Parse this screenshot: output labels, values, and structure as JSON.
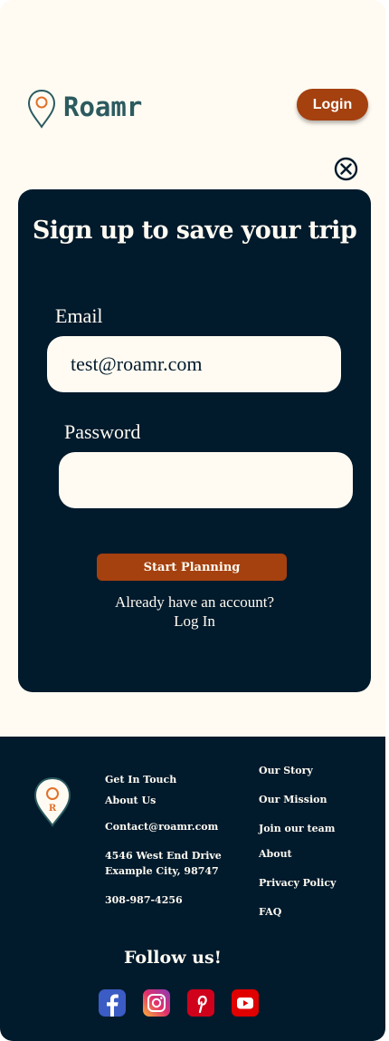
{
  "header": {
    "brand": "Roamr",
    "login_label": "Login"
  },
  "modal": {
    "title": "Sign up to save your trip",
    "email_label": "Email",
    "email_value": "test@roamr.com",
    "password_label": "Password",
    "password_value": "",
    "submit_label": "Start Planning",
    "already_text": "Already have an account?",
    "login_link": "Log In"
  },
  "footer": {
    "get_in_touch": "Get In Touch",
    "about_us": "About Us",
    "email": "Contact@roamr.com",
    "address_line1": "4546 West End Drive",
    "address_line2": "Example City, 98747",
    "phone": "308-987-4256",
    "links": [
      "Our Story",
      "Our Mission",
      "Join our team",
      "About",
      "Privacy Policy",
      "FAQ"
    ],
    "follow": "Follow us!",
    "logo_letter": "R"
  },
  "social": [
    "facebook-icon",
    "instagram-icon",
    "pinterest-icon",
    "youtube-icon"
  ],
  "colors": {
    "accent": "#a5400f",
    "navy": "#011a2c",
    "cream": "#fffbf2",
    "teal": "#2b5a5f",
    "pin_orange": "#e0702a"
  }
}
